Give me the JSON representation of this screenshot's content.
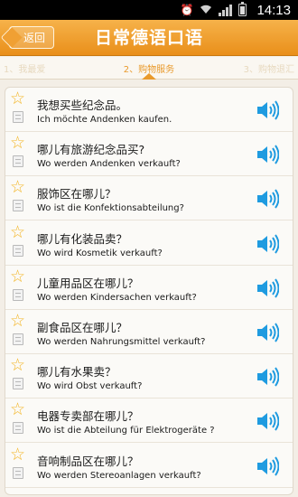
{
  "status_bar": {
    "time": "14:13",
    "icons": [
      "alarm-icon",
      "wifi-icon",
      "signal-icon",
      "battery-icon"
    ]
  },
  "header": {
    "back_label": "返回",
    "title": "日常德语口语"
  },
  "tabs": [
    {
      "label": "1、我最爱"
    },
    {
      "label": "2、购物服务",
      "active": true
    },
    {
      "label": "3、购物退汇"
    }
  ],
  "colors": {
    "accent": "#e98f1a",
    "speaker": "#1f9be0",
    "star": "#f3b526"
  },
  "phrases": [
    {
      "zh": "我想买些纪念品。",
      "de": "Ich möchte Andenken kaufen."
    },
    {
      "zh": "哪儿有旅游纪念品买?",
      "de": "Wo werden Andenken verkauft?"
    },
    {
      "zh": "服饰区在哪儿？",
      "de": "Wo ist die Konfektionsabteilung?"
    },
    {
      "zh": "哪儿有化装品卖？",
      "de": "Wo wird Kosmetik verkauft?"
    },
    {
      "zh": "儿童用品区在哪儿？",
      "de": "Wo werden Kindersachen verkauft?"
    },
    {
      "zh": "副食品区在哪儿？",
      "de": "Wo werden Nahrungsmittel verkauft?"
    },
    {
      "zh": "哪儿有水果卖？",
      "de": "Wo wird Obst verkauft?"
    },
    {
      "zh": "电器专卖部在哪儿？",
      "de": "Wo ist die Abteilung für Elektrogeräte ?"
    },
    {
      "zh": "音响制品区在哪儿？",
      "de": "Wo werden Stereoanlagen verkauft?"
    }
  ]
}
